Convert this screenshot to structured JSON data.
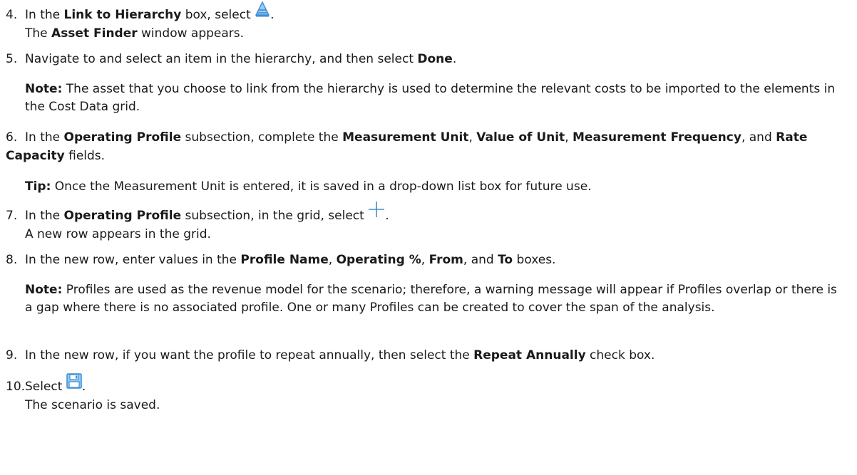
{
  "steps": [
    {
      "number": "4.",
      "line_parts": [
        "In the ",
        "Link to Hierarchy",
        " box, select ",
        "."
      ],
      "icon": "hierarchy-icon",
      "result": [
        "The ",
        "Asset Finder",
        " window appears."
      ]
    },
    {
      "number": "5.",
      "line_parts": [
        "Navigate to and select an item in the hierarchy, and then select ",
        "Done",
        "."
      ],
      "note_label": "Note:",
      "note_text": " The asset that you choose to link from the hierarchy is used to determine the relevant costs to be imported to the elements in the Cost Data grid."
    },
    {
      "number": "6.",
      "line_parts": [
        "In the ",
        "Operating Profile",
        " subsection, complete the ",
        "Measurement Unit",
        ", ",
        "Value of Unit",
        ", ",
        "Measurement Frequency",
        ", and ",
        "Rate Capacity",
        " fields."
      ],
      "tip_label": "Tip:",
      "tip_text": " Once the Measurement Unit is entered, it is saved in a drop-down list box for future use."
    },
    {
      "number": "7.",
      "line_parts": [
        "In the ",
        "Operating Profile",
        " subsection, in the grid, select ",
        "."
      ],
      "icon": "plus-icon",
      "result": [
        "A new row appears in the grid."
      ]
    },
    {
      "number": "8.",
      "line_parts": [
        "In the new row, enter values in the ",
        "Profile Name",
        ", ",
        "Operating %",
        ", ",
        "From",
        ", and ",
        "To",
        " boxes."
      ],
      "note_label": "Note:",
      "note_text": " Profiles are used as the revenue model for the scenario; therefore, a warning message will appear if Profiles overlap or there is a gap where there is no associated profile. One or many Profiles can be created to cover the span of the analysis."
    },
    {
      "number": "9.",
      "line_parts": [
        "In the new row, if you want the profile to repeat annually, then select the ",
        "Repeat Annually",
        " check box."
      ]
    },
    {
      "number": "10.",
      "line_parts": [
        "Select ",
        "."
      ],
      "icon": "save-icon",
      "result": [
        "The scenario is saved."
      ]
    }
  ],
  "colors": {
    "icon_blue": "#3b8fd4",
    "icon_light_blue": "#9ccaf0",
    "text": "#1a1a1a"
  }
}
